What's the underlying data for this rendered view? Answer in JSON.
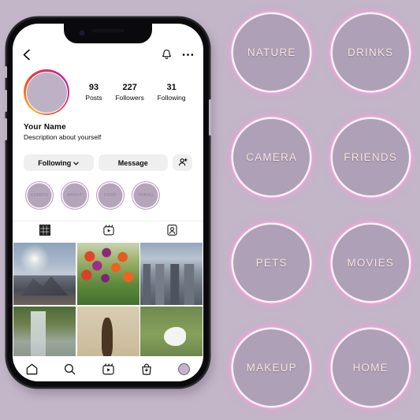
{
  "theme": {
    "background": "#c3b6c8",
    "cover_fill": "#aea0b6",
    "cover_ring_pink": "#e3a8d6",
    "cover_ring_white": "#fdf4fa",
    "cover_text": "#f6e4dc",
    "highlight_fill": "#b4a5bb",
    "phone_frame": "#0a0a0c",
    "screen": "#ffffff"
  },
  "phone": {
    "header": {
      "back_icon": "chevron-left-icon",
      "bell_icon": "bell-icon",
      "menu_icon": "more-options-icon"
    },
    "profile": {
      "avatar": "profile-avatar",
      "name": "Your Name",
      "description": "Description about yourself",
      "stats": [
        {
          "value": "93",
          "label": "Posts"
        },
        {
          "value": "227",
          "label": "Followers"
        },
        {
          "value": "31",
          "label": "Following"
        }
      ]
    },
    "actions": {
      "following_label": "Following",
      "following_caret": "⌄",
      "message_label": "Message",
      "add_person_icon": "add-person-icon"
    },
    "highlights": [
      {
        "label": "EVENTS"
      },
      {
        "label": "ABOUT"
      },
      {
        "label": "FOOD"
      },
      {
        "label": "TRAVEL"
      }
    ],
    "tabs": [
      {
        "icon": "grid-icon",
        "active": true
      },
      {
        "icon": "reels-icon",
        "active": false
      },
      {
        "icon": "tagged-icon",
        "active": false
      }
    ],
    "grid_photos": [
      {
        "alt": "mountain-sunrise",
        "style": "ph-mountain"
      },
      {
        "alt": "tulip-field",
        "style": "ph-tulips"
      },
      {
        "alt": "city-skyline",
        "style": "ph-city"
      },
      {
        "alt": "waterfall-forest",
        "style": "ph-falls"
      },
      {
        "alt": "beige-still-life",
        "style": "ph-beige"
      },
      {
        "alt": "white-bird-grass",
        "style": "ph-bird"
      }
    ],
    "bottom_nav": [
      {
        "icon": "home-icon"
      },
      {
        "icon": "search-icon"
      },
      {
        "icon": "reels-icon"
      },
      {
        "icon": "shop-icon"
      },
      {
        "icon": "profile-avatar-icon"
      }
    ]
  },
  "covers": [
    {
      "label": "NATURE"
    },
    {
      "label": "DRINKS"
    },
    {
      "label": "CAMERA"
    },
    {
      "label": "FRIENDS"
    },
    {
      "label": "PETS"
    },
    {
      "label": "MOVIES"
    },
    {
      "label": "MAKEUP"
    },
    {
      "label": "HOME"
    }
  ]
}
